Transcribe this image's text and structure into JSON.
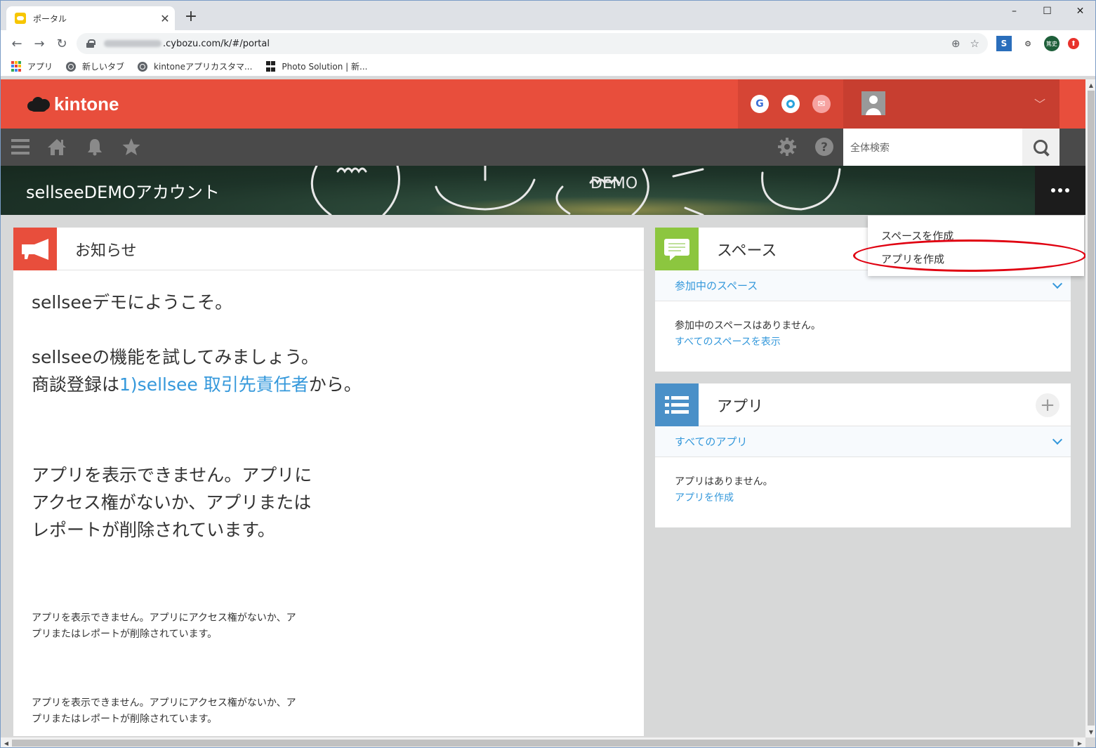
{
  "browser": {
    "tab_title": "ポータル",
    "tab_close": "✕",
    "new_tab": "+",
    "url_visible": ".cybozu.com/k/#/portal",
    "profile_badge": "篤史",
    "bookmarks": [
      {
        "label": "アプリ"
      },
      {
        "label": "新しいタブ"
      },
      {
        "label": "kintoneアプリカスタマ..."
      },
      {
        "label": "Photo Solution | 新..."
      }
    ],
    "window_controls": [
      "–",
      "☐",
      "✕"
    ]
  },
  "kintone": {
    "logo_text": "kintone",
    "services": [
      "G",
      "",
      "✉"
    ],
    "search_placeholder": "全体検索",
    "space_title": "sellseeDEMOアカウント",
    "dropdown": [
      "スペースを作成",
      "アプリを作成"
    ],
    "notice": {
      "title": "お知らせ",
      "welcome": "sellseeデモにようこそ。",
      "line1": "sellseeの機能を試してみましょう。",
      "line2_prefix": "商談登録は",
      "line2_link": "1)sellsee 取引先責任者",
      "line2_suffix": "から。",
      "error_big_1": "アプリを表示できません。アプリに",
      "error_big_2": "アクセス権がないか、アプリまたは",
      "error_big_3": "レポートが削除されています。",
      "error_small_a1": "アプリを表示できません。アプリにアクセス権がないか、ア",
      "error_small_a2": "プリまたはレポートが削除されています。",
      "error_small_b1": "アプリを表示できません。アプリにアクセス権がないか、ア",
      "error_small_b2": "プリまたはレポートが削除されています。"
    },
    "spaces": {
      "title": "スペース",
      "filter": "参加中のスペース",
      "empty": "参加中のスペースはありません。",
      "link": "すべてのスペースを表示"
    },
    "apps": {
      "title": "アプリ",
      "filter": "すべてのアプリ",
      "empty": "アプリはありません。",
      "link": "アプリを作成",
      "add": "+"
    }
  },
  "colors": {
    "header_red": "#e84e3c",
    "nav_gray": "#4a4a4a",
    "link_blue": "#3498db",
    "highlight_red": "#e00010"
  }
}
